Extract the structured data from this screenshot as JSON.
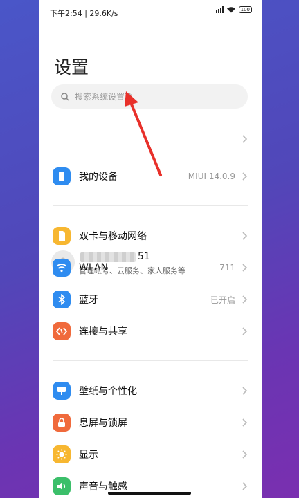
{
  "status": {
    "time": "下午2:54 | 29.6K/s",
    "battery": "100"
  },
  "page": {
    "title": "设置"
  },
  "search": {
    "placeholder": "搜索系统设置项"
  },
  "account": {
    "name_visible": "51",
    "subtitle": "管理帐号、云服务、家人服务等"
  },
  "device": {
    "label": "我的设备",
    "value": "MIUI 14.0.9"
  },
  "network": {
    "items": [
      {
        "label": "双卡与移动网络",
        "value": ""
      },
      {
        "label": "WLAN",
        "value": "711"
      },
      {
        "label": "蓝牙",
        "value": "已开启"
      },
      {
        "label": "连接与共享",
        "value": ""
      }
    ]
  },
  "personal": {
    "items": [
      {
        "label": "壁纸与个性化",
        "value": ""
      },
      {
        "label": "息屏与锁屏",
        "value": ""
      },
      {
        "label": "显示",
        "value": ""
      },
      {
        "label": "声音与触感",
        "value": ""
      }
    ]
  },
  "colors": {
    "device": "#2f8cf0",
    "sim": "#f7b731",
    "wlan": "#2f8cf0",
    "bluetooth": "#2f8cf0",
    "share": "#f06a3c",
    "wallpaper": "#2f8cf0",
    "lock": "#f06a3c",
    "display": "#f7b731",
    "sound": "#3bbf6a",
    "arrow": "#e8302a"
  },
  "icons": [
    "search-icon",
    "avatar-icon",
    "phone-icon",
    "sim-icon",
    "wifi-icon",
    "bluetooth-icon",
    "share-icon",
    "wallpaper-icon",
    "lock-icon",
    "sun-icon",
    "sound-icon",
    "chevron-right-icon"
  ]
}
